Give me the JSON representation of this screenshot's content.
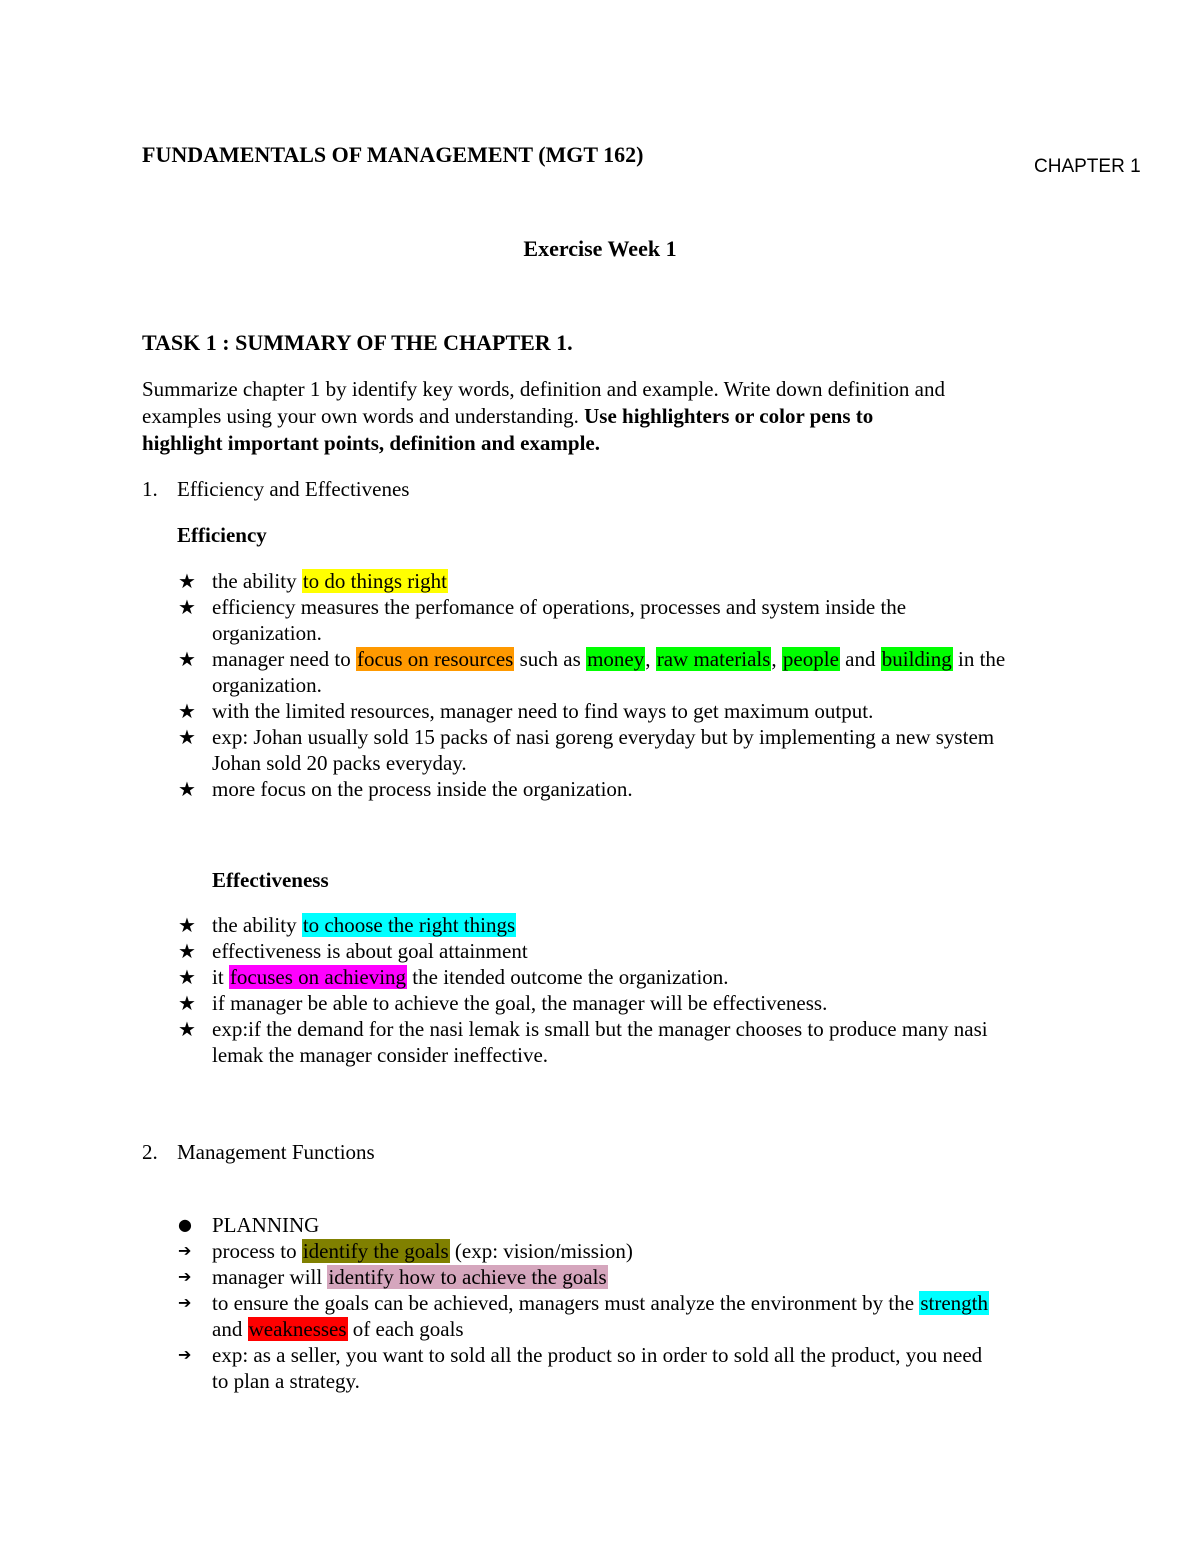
{
  "header": {
    "course_title": "FUNDAMENTALS OF MANAGEMENT (MGT 162)",
    "chapter_label": "CHAPTER 1",
    "exercise_title": "Exercise Week 1"
  },
  "task": {
    "title": "TASK 1 : SUMMARY OF THE CHAPTER 1.",
    "instructions_line1": "Summarize chapter 1 by identify key words, definition and example. Write down  definition and",
    "instructions_line2_plain": "examples using your own words and understanding. ",
    "instructions_line2_bold": "Use highlighters or color pens  to",
    "instructions_line3_bold": "highlight important points, definition and example."
  },
  "highlight_colors": {
    "yellow": "#ffff00",
    "orange": "#ff9900",
    "green": "#00ff00",
    "cyan": "#00ffff",
    "magenta": "#ff00ff",
    "olive": "#808000",
    "pink": "#d5a6bd",
    "red": "#ff0000"
  },
  "section1": {
    "number": "1.",
    "title": "Efficiency and Effectivenes",
    "efficiency": {
      "heading": "Efficiency",
      "bullet_icon": "★",
      "items": [
        {
          "pre": "the ability ",
          "hl": "to do things right"
        },
        {
          "line1": "efficiency measures the perfomance of operations, processes and system inside the",
          "line2": "organization."
        },
        {
          "pre": "manager need to ",
          "hl1": "focus on resources",
          "mid1": " such as ",
          "hl2": "money",
          "mid2": ", ",
          "hl3": "raw materials",
          "mid3": ", ",
          "hl4": "people",
          "mid4": " and ",
          "hl5": "building",
          "post": " in the",
          "line2": "organization."
        },
        {
          "text": "with the limited resources, manager need to find ways to get maximum output."
        },
        {
          "line1": "exp: Johan usually sold 15 packs of nasi goreng everyday but by implementing a new system",
          "line2": "Johan sold 20 packs everyday."
        },
        {
          "text": "more focus on the process inside the organization."
        }
      ]
    },
    "effectiveness": {
      "heading": "Effectiveness",
      "items": [
        {
          "pre": "the ability ",
          "hl": "to choose the right things"
        },
        {
          "text": "effectiveness is about goal attainment"
        },
        {
          "pre": "it ",
          "hl": "focuses on achieving",
          "post": " the itended outcome the organization."
        },
        {
          "text": "if manager be able to achieve the goal, the manager will be effectiveness."
        },
        {
          "line1": "exp:if the demand for the nasi lemak is small but the manager chooses to produce many nasi",
          "line2": "lemak the manager consider ineffective."
        }
      ]
    }
  },
  "section2": {
    "number": "2.",
    "title": "Management Functions",
    "planning": {
      "bullet_icon": "●",
      "arrow_icon": "➔",
      "heading": "PLANNING",
      "items": [
        {
          "pre": "process to ",
          "hl": "identify the goals",
          "post": " (exp: vision/mission)"
        },
        {
          "pre": "manager will ",
          "hl": "identify how to achieve the goals"
        },
        {
          "pre": "to ensure the goals can be achieved, managers must analyze the environment by the ",
          "hl": "strength",
          "line2_pre": "and ",
          "line2_hl": "weaknesses",
          "line2_post": " of each goals"
        },
        {
          "line1": "exp: as a seller, you want to sold all the product so in order to sold all the product, you need",
          "line2": "to plan a strategy."
        }
      ]
    }
  }
}
